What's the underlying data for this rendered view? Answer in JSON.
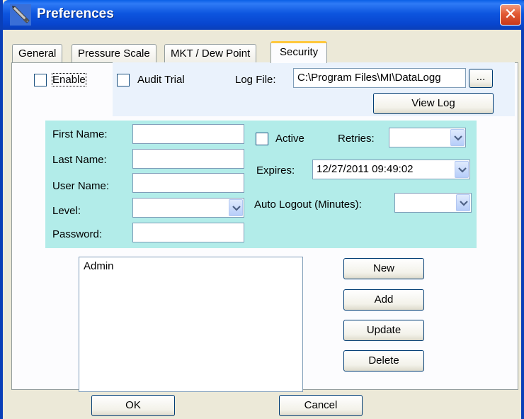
{
  "window": {
    "title": "Preferences",
    "close_glyph": "✕"
  },
  "tabs": [
    {
      "label": "General"
    },
    {
      "label": "Pressure Scale"
    },
    {
      "label": "MKT / Dew Point"
    },
    {
      "label": "Security"
    }
  ],
  "security": {
    "enable_label": "Enable",
    "audit_label": "Audit Trial",
    "logfile_label": "Log File:",
    "logfile_value": "C:\\Program Files\\MI\\DataLogg",
    "browse_label": "...",
    "viewlog_label": "View Log"
  },
  "user_form": {
    "first_name_label": "First Name:",
    "last_name_label": "Last Name:",
    "user_name_label": "User Name:",
    "level_label": "Level:",
    "password_label": "Password:",
    "active_label": "Active",
    "retries_label": "Retries:",
    "expires_label": "Expires:",
    "expires_value": "12/27/2011 09:49:02",
    "auto_logout_label": "Auto Logout (Minutes):"
  },
  "users": {
    "items": [
      "Admin"
    ]
  },
  "buttons": {
    "new": "New",
    "add": "Add",
    "update": "Update",
    "delete": "Delete",
    "ok": "OK",
    "cancel": "Cancel"
  },
  "colors": {
    "title_bar": "#0a5fe6",
    "panel": "#b2ece9",
    "tab_highlight": "#ffc83c",
    "close_button": "#e25a34"
  },
  "icons": {
    "title": "pen-icon",
    "close": "close-icon",
    "dropdown": "chevron-down-icon"
  }
}
